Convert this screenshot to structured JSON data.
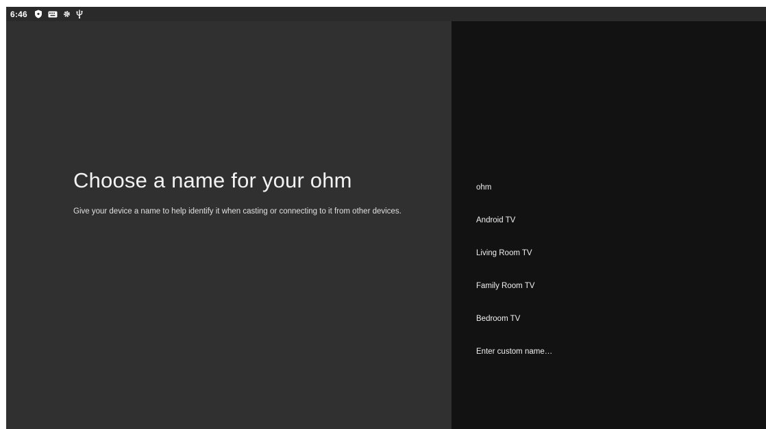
{
  "status_bar": {
    "time": "6:46",
    "icons": [
      "shield-icon",
      "keyboard-icon",
      "settings-gear-icon",
      "usb-icon"
    ]
  },
  "setup": {
    "title": "Choose a name for your ohm",
    "description": "Give your device a name to help identify it when casting or connecting to it from other devices."
  },
  "name_options": [
    {
      "label": "ohm"
    },
    {
      "label": "Android TV"
    },
    {
      "label": "Living Room TV"
    },
    {
      "label": "Family Room TV"
    },
    {
      "label": "Bedroom TV"
    },
    {
      "label": "Enter custom name…"
    }
  ],
  "colors": {
    "left_panel": "#303030",
    "right_panel": "#121212",
    "text": "#f0f0f0"
  }
}
